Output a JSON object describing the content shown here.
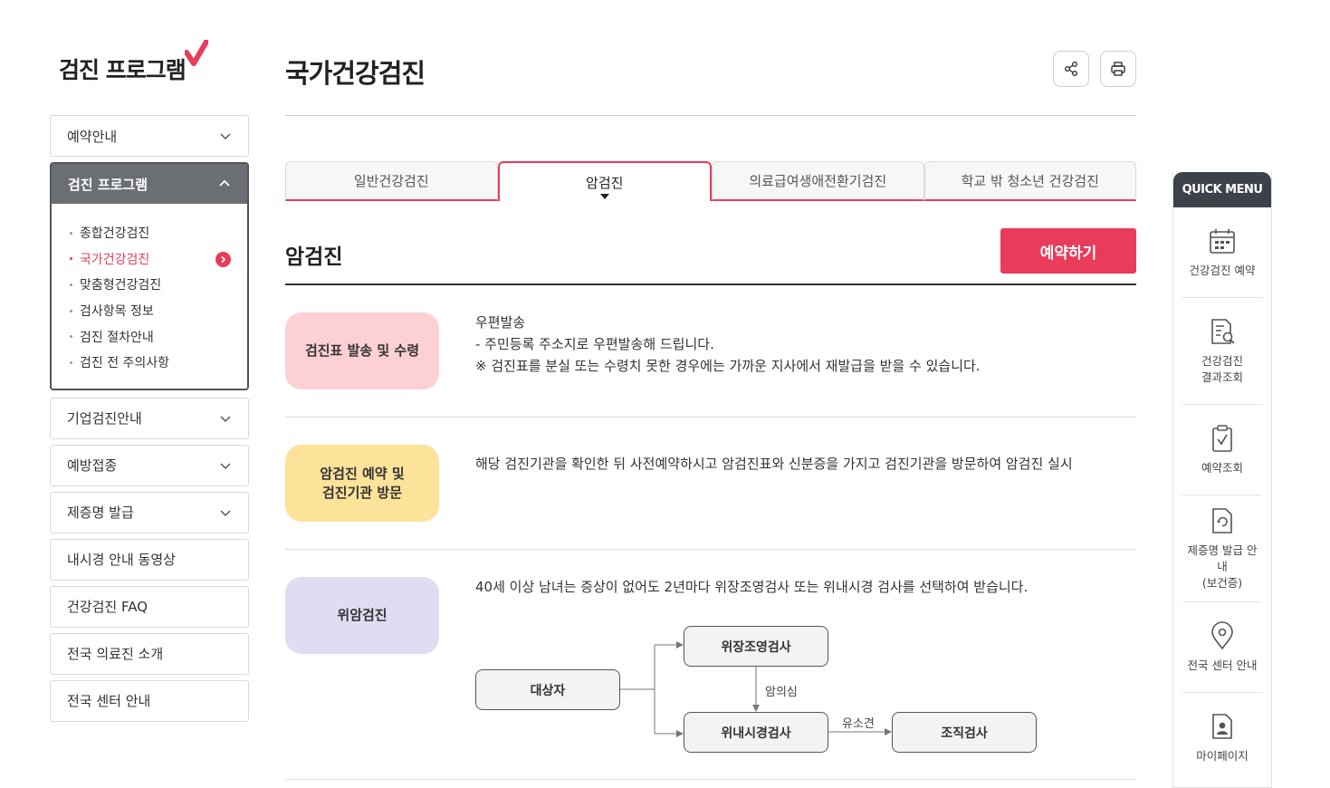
{
  "sidebar": {
    "title": "검진 프로그램",
    "items_top": [
      {
        "label": "예약안내"
      }
    ],
    "open_menu": {
      "label": "검진 프로그램",
      "subitems": [
        {
          "label": "종합건강검진"
        },
        {
          "label": "국가건강검진"
        },
        {
          "label": "맞춤형건강검진"
        },
        {
          "label": "검사항목 정보"
        },
        {
          "label": "검진 절차안내"
        },
        {
          "label": "검진 전 주의사항"
        }
      ]
    },
    "items_bottom": [
      {
        "label": "기업검진안내"
      },
      {
        "label": "예방접종"
      },
      {
        "label": "제증명 발급"
      },
      {
        "label": "내시경 안내 동영상"
      },
      {
        "label": "건강검진 FAQ"
      },
      {
        "label": "전국 의료진 소개"
      },
      {
        "label": "전국 센터 안내"
      }
    ]
  },
  "header": {
    "title": "국가건강검진"
  },
  "tabs": [
    {
      "label": "일반건강검진"
    },
    {
      "label": "암검진"
    },
    {
      "label": "의료급여생애전환기검진"
    },
    {
      "label": "학교 밖 청소년 건강검진"
    }
  ],
  "section": {
    "title": "암검진",
    "reserve_label": "예약하기",
    "steps": [
      {
        "badge": "검진표 발송 및 수령",
        "lines": [
          "우편발송",
          "- 주민등록 주소지로 우편발송해 드립니다.",
          "※ 검진표를 분실 또는 수령치 못한 경우에는 가까운 지사에서 재발급을 받을 수 있습니다."
        ]
      },
      {
        "badge_line1": "암검진 예약 및",
        "badge_line2": "검진기관 방문",
        "text": "해당 검진기관을 확인한 뒤 사전예약하시고 암검진표와 신분증을 가지고 검진기관을 방문하여 암검진 실시"
      },
      {
        "badge": "위암검진",
        "text": "40세 이상 남녀는 증상이 없어도 2년마다 위장조영검사 또는 위내시경 검사를 선택하여 받습니다."
      }
    ],
    "flow": {
      "subject": "대상자",
      "upper": "위장조영검사",
      "lower": "위내시경검사",
      "biopsy": "조직검사",
      "suspect_label": "암의심",
      "finding_label": "유소견"
    }
  },
  "quick_menu": {
    "title": "QUICK MENU",
    "items": [
      {
        "line1": "건강검진 예약",
        "line2": ""
      },
      {
        "line1": "건강검진",
        "line2": "결과조회"
      },
      {
        "line1": "예약조회",
        "line2": ""
      },
      {
        "line1": "제증명 발급 안내",
        "line2": "(보건증)"
      },
      {
        "line1": "전국 센터 안내",
        "line2": ""
      },
      {
        "line1": "마이페이지",
        "line2": ""
      }
    ]
  },
  "colors": {
    "accent": "#e83c5a",
    "badge_pink": "#fdd0d4",
    "badge_yellow": "#fde29a",
    "badge_purple": "#e2dcf3",
    "dark": "#3d4149"
  }
}
